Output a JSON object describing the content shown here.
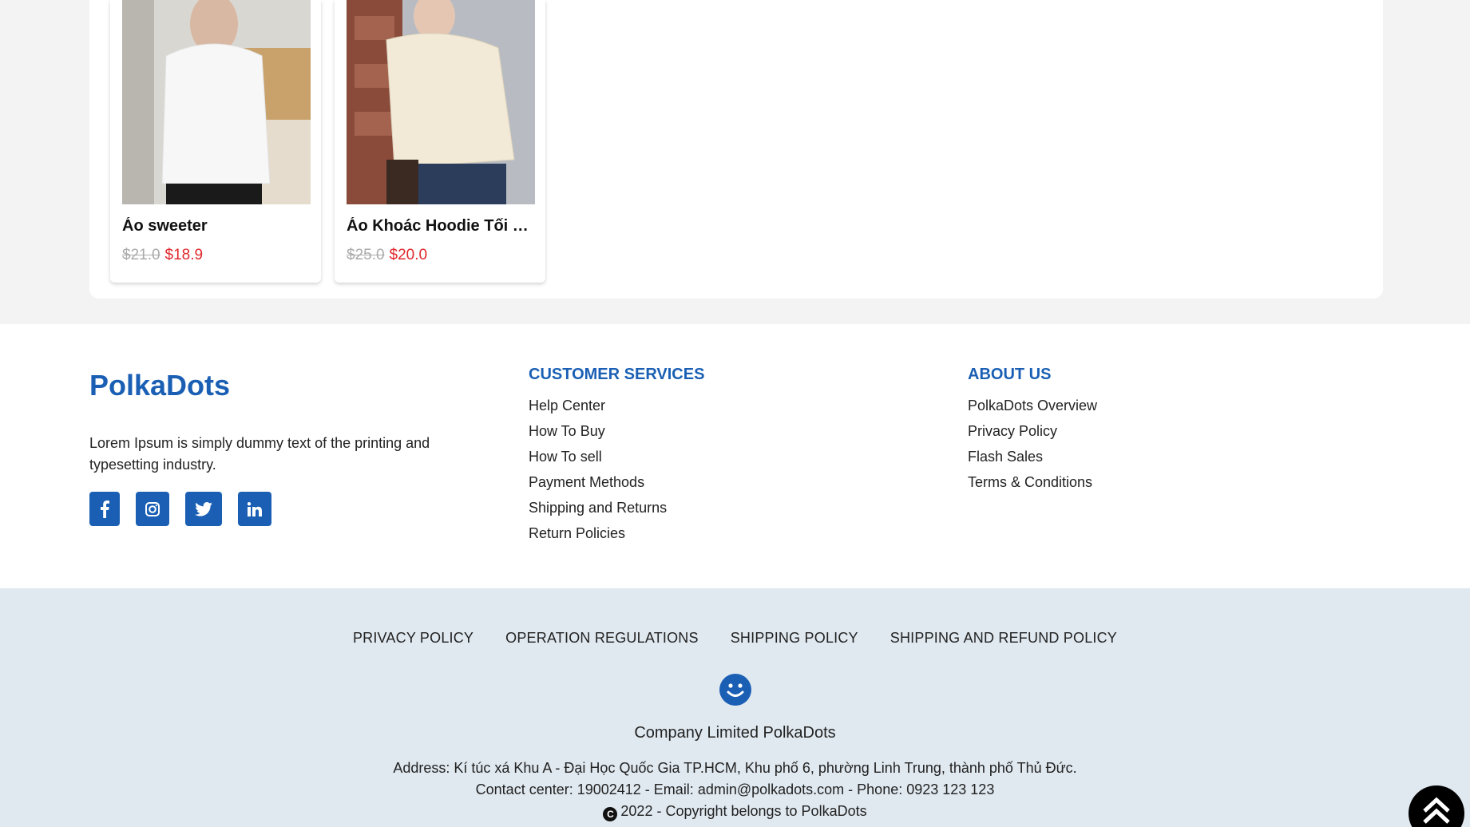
{
  "products": [
    {
      "name": "Áo sweeter",
      "old_price": "$21.0",
      "new_price": "$18.9",
      "image": "white-sweater-photo"
    },
    {
      "name": "Áo Khoác Hoodie Tối G...",
      "old_price": "$25.0",
      "new_price": "$20.0",
      "image": "cream-hoodie-photo"
    }
  ],
  "footer": {
    "brand": "PolkaDots",
    "description": "Lorem Ipsum is simply dummy text of the printing and typesetting industry.",
    "socials": [
      "facebook-icon",
      "instagram-icon",
      "twitter-icon",
      "linkedin-icon"
    ],
    "customer_services": {
      "title": "CUSTOMER SERVICES",
      "items": [
        "Help Center",
        "How To Buy",
        "How To sell",
        "Payment Methods",
        "Shipping and Returns",
        "Return Policies"
      ]
    },
    "about_us": {
      "title": "ABOUT US",
      "items": [
        "PolkaDots Overview",
        "Privacy Policy",
        "Flash Sales",
        "Terms & Conditions"
      ]
    }
  },
  "bottom": {
    "policies": [
      "PRIVACY POLICY",
      "OPERATION REGULATIONS",
      "SHIPPING POLICY",
      "SHIPPING AND REFUND POLICY"
    ],
    "company": "Company Limited PolkaDots",
    "address": "Address: Kí túc xá Khu A - Đại Học Quốc Gia TP.HCM, Khu phố 6, phường Linh Trung, thành phố Thủ Đức.",
    "contact": "Contact center: 19002412 - Email: admin@polkadots.com - Phone: 0923 123 123",
    "copyright": "2022 - Copyright belongs to PolkaDots"
  },
  "colors": {
    "brand": "#1a5fb4",
    "sale": "#e0272b",
    "footer_bottom_bg": "#e0e9f0"
  }
}
